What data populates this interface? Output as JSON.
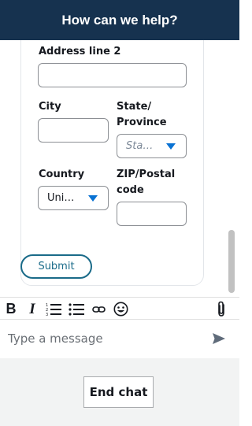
{
  "header": {
    "title": "How can we help?"
  },
  "form": {
    "address_line2_label": "Address line 2",
    "city_label": "City",
    "state_label_line1": "State/",
    "state_label_line2": "Province",
    "state_placeholder": "Sta…",
    "country_label": "Country",
    "country_value": "Uni…",
    "zip_label_line1": "ZIP/Postal",
    "zip_label_line2": "code",
    "submit_label": "Submit"
  },
  "toolbar": {
    "bold_glyph": "B",
    "italic_glyph": "I",
    "icons": [
      "bold-icon",
      "italic-icon",
      "numbered-list-icon",
      "bullet-list-icon",
      "link-icon",
      "emoji-icon",
      "attachment-icon"
    ]
  },
  "composer": {
    "placeholder": "Type a message"
  },
  "footer": {
    "end_chat_label": "End chat"
  },
  "colors": {
    "header_bg": "#16324f",
    "accent": "#0972d3",
    "submit_border": "#1a6b89"
  }
}
